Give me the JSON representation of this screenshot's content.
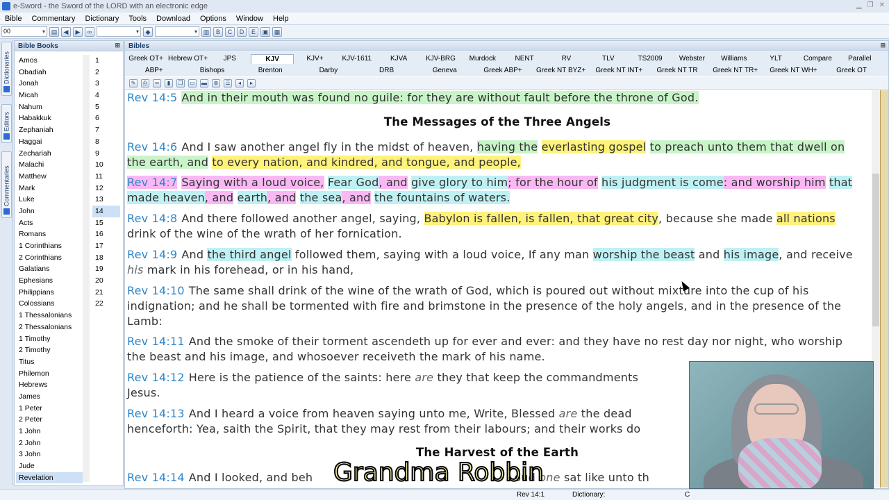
{
  "window": {
    "title": "e-Sword - the Sword of the LORD with an electronic edge"
  },
  "menu": [
    "Bible",
    "Commentary",
    "Dictionary",
    "Tools",
    "Download",
    "Options",
    "Window",
    "Help"
  ],
  "toolbar": {
    "combo1_value": "00"
  },
  "side_tabs": [
    "Dictionaries",
    "Editors",
    "Commentaries"
  ],
  "books_panel": {
    "title": "Bible Books",
    "books": [
      "Amos",
      "Obadiah",
      "Jonah",
      "Micah",
      "Nahum",
      "Habakkuk",
      "Zephaniah",
      "Haggai",
      "Zechariah",
      "Malachi",
      "Matthew",
      "Mark",
      "Luke",
      "John",
      "Acts",
      "Romans",
      "1 Corinthians",
      "2 Corinthians",
      "Galatians",
      "Ephesians",
      "Philippians",
      "Colossians",
      "1 Thessalonians",
      "2 Thessalonians",
      "1 Timothy",
      "2 Timothy",
      "Titus",
      "Philemon",
      "Hebrews",
      "James",
      "1 Peter",
      "2 Peter",
      "1 John",
      "2 John",
      "3 John",
      "Jude",
      "Revelation"
    ],
    "selected_book": "Revelation",
    "chapters": [
      "1",
      "2",
      "3",
      "4",
      "5",
      "6",
      "7",
      "8",
      "9",
      "10",
      "11",
      "12",
      "13",
      "14",
      "15",
      "16",
      "17",
      "18",
      "19",
      "20",
      "21",
      "22"
    ],
    "selected_chapter": "14"
  },
  "bibles_panel": {
    "title": "Bibles",
    "tabs_row1": [
      "Greek OT+",
      "Hebrew OT+",
      "JPS",
      "KJV",
      "KJV+",
      "KJV-1611",
      "KJVA",
      "KJV-BRG",
      "Murdock",
      "NENT",
      "RV",
      "TLV",
      "TS2009",
      "Webster",
      "Williams",
      "YLT",
      "Compare",
      "Parallel"
    ],
    "tabs_row2": [
      "ABP+",
      "Bishops",
      "Brenton",
      "Darby",
      "DRB",
      "Geneva",
      "Greek ABP+",
      "Greek NT BYZ+",
      "Greek NT INT+",
      "Greek NT TR",
      "Greek NT TR+",
      "Greek NT WH+",
      "Greek OT"
    ],
    "active_tab": "KJV"
  },
  "text": {
    "v5": {
      "ref": "Rev 14:5",
      "t1": "And in their mouth was found no guile: for they are without fault before the throne of God."
    },
    "heading1": "The Messages of the Three Angels",
    "v6": {
      "ref": "Rev 14:6",
      "t1": "And I saw another angel fly in the midst of heaven,",
      "t2": "having the",
      "t3": "everlasting gospel",
      "t4": "to preach unto them that dwell on the earth, and",
      "t5": "to every nation, and kindred, and tongue, and people,"
    },
    "v7": {
      "ref": "Rev 14:7",
      "t1": "Saying with a loud voice,",
      "t2": "Fear God",
      "t3": ", and",
      "t4": "give glory to him",
      "t5": "; for the hour of",
      "t6": "his judgment is come",
      "t7": ": and worship him",
      "t8": "that made heaven",
      "t9": ", and",
      "t10": "earth",
      "t11": ", and",
      "t12": "the sea",
      "t13": ", and",
      "t14": "the fountains of waters."
    },
    "v8": {
      "ref": "Rev 14:8",
      "t1": "And there followed another angel, saying,",
      "t2": "Babylon is fallen, is fallen, that great city",
      "t3": ", because she made",
      "t4": "all nations",
      "t5": "drink of the wine of the wrath of her fornication."
    },
    "v9": {
      "ref": "Rev 14:9",
      "t1": "And",
      "t2": "the third angel",
      "t3": "followed them, saying with a loud voice, If any man",
      "t4": "worship the beast",
      "t5": "and",
      "t6": "his image",
      "t7": ", and receive",
      "t8": "his",
      "t9": "mark in his forehead, or in his hand,"
    },
    "v10": {
      "ref": "Rev 14:10",
      "t1": "The same shall drink of the wine of the wrath of God, which is poured out without mixture into the cup of his indignation; and he shall be tormented with fire and brimstone in the presence of the holy angels, and in the presence of the Lamb:"
    },
    "v11": {
      "ref": "Rev 14:11",
      "t1": "And the smoke of their torment ascendeth up for ever and ever: and they have no rest day nor night, who worship the beast and his image, and whosoever receiveth the mark of his name."
    },
    "v12": {
      "ref": "Rev 14:12",
      "t1": "Here is the patience of the saints: here",
      "t2": "are",
      "t3": "they that keep the commandments",
      "t4": "Jesus."
    },
    "v13": {
      "ref": "Rev 14:13",
      "t1": "And I heard a voice from heaven saying unto me, Write, Blessed",
      "t2": "are",
      "t3": "the dead",
      "t4": "henceforth: Yea, saith the Spirit, that they may rest from their labours; and their works do"
    },
    "heading2": "The Harvest of the Earth",
    "v14": {
      "ref": "Rev 14:14",
      "t1": "And I looked, and beh",
      "t2": "oud",
      "t3": "one",
      "t4": "sat like unto th"
    }
  },
  "status": {
    "ref": "Rev 14:1",
    "dictionary_label": "Dictionary:",
    "edge": "C"
  },
  "overlay": {
    "name": "Grandma Robbin"
  },
  "colors": {
    "green_highlight": "#c9f4c9",
    "yellow_highlight": "#fff27a",
    "pink_highlight": "#f9b8f4",
    "cyan_highlight": "#bff1f4",
    "ref_blue": "#2f86c8"
  }
}
